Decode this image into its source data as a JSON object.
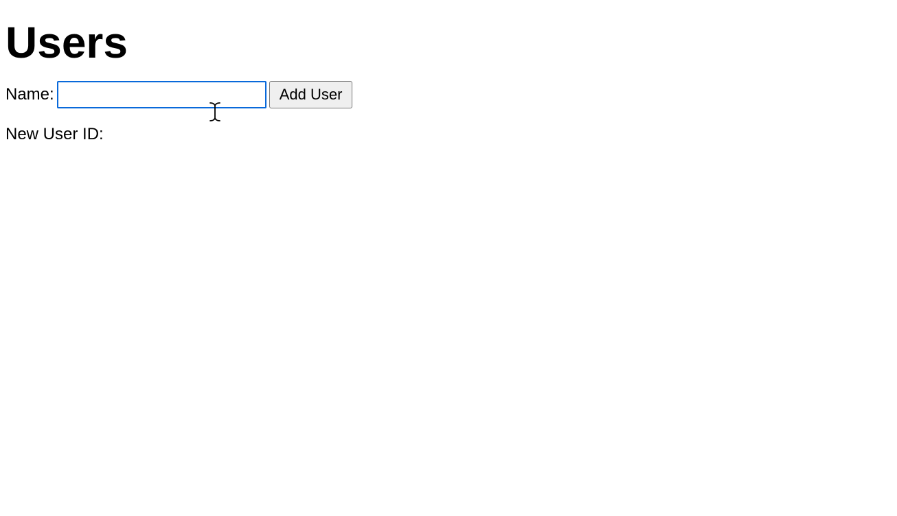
{
  "page": {
    "title": "Users"
  },
  "form": {
    "name_label": "Name: ",
    "name_value": "",
    "add_button_label": "Add User"
  },
  "result": {
    "label": "New User ID: ",
    "value": ""
  }
}
